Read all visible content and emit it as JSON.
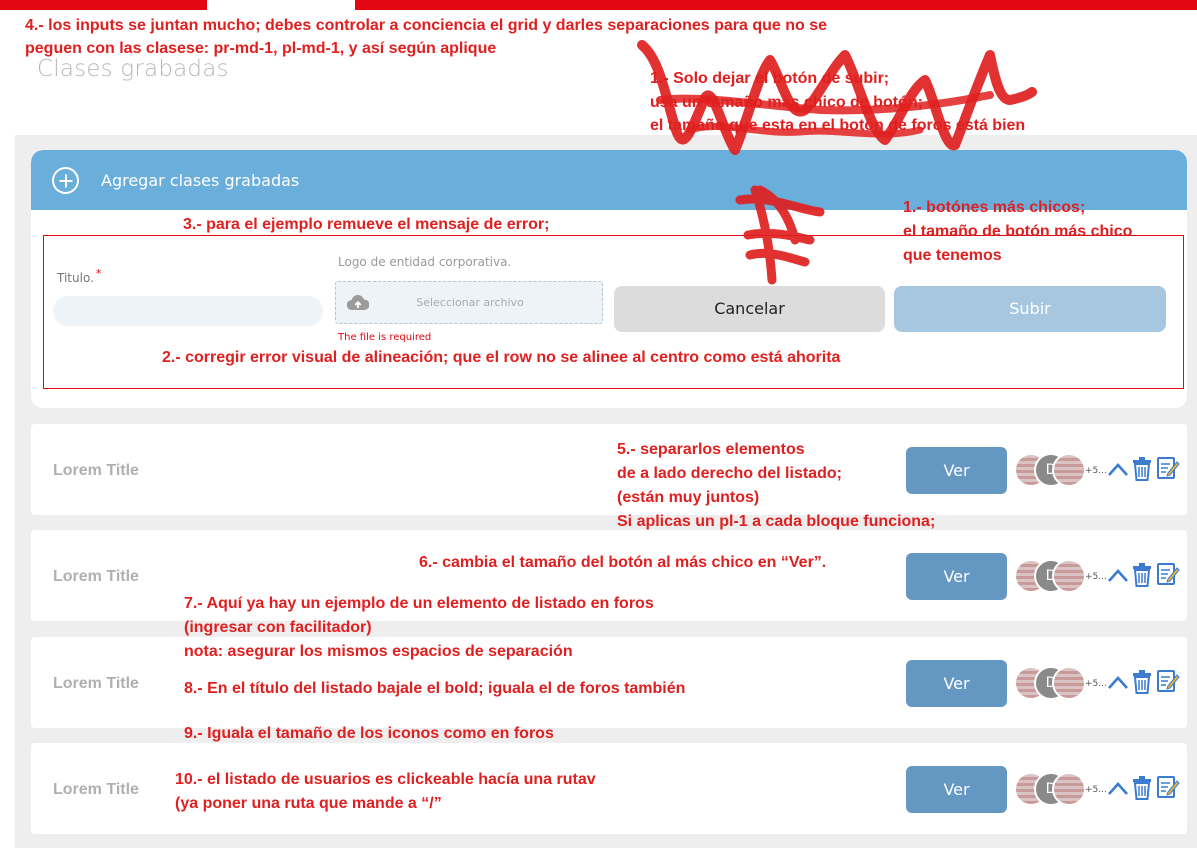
{
  "page": {
    "title": "Clases grabadas"
  },
  "add_card": {
    "title": "Agregar clases grabadas",
    "title_label": "Titulo.",
    "required_mark": "*",
    "title_value": "",
    "file_label": "Logo de entidad corporativa.",
    "file_button": "Seleccionar archivo",
    "file_error": "The file is required",
    "cancel_label": "Cancelar",
    "upload_label": "Subir"
  },
  "list": {
    "rows": [
      {
        "title": "Lorem Title",
        "view_label": "Ver",
        "avatar_initial": "D",
        "more_count": "+5..."
      },
      {
        "title": "Lorem Title",
        "view_label": "Ver",
        "avatar_initial": "D",
        "more_count": "+5..."
      },
      {
        "title": "Lorem Title",
        "view_label": "Ver",
        "avatar_initial": "D",
        "more_count": "+5..."
      },
      {
        "title": "Lorem Title",
        "view_label": "Ver",
        "avatar_initial": "D",
        "more_count": "+5..."
      }
    ]
  },
  "annotations": {
    "a4_line1": "4.- los inputs se juntan mucho; debes controlar a conciencia el grid y darles separaciones para que no se",
    "a4_line2": "peguen con las clasese: pr-md-1, pl-md-1, y así según aplique",
    "a_upload_line1": "1.- Solo dejar el botón de subir;",
    "a_upload_line2": "usa un tamaño más chico de botón;",
    "a_upload_line3": "el tamaño que esta en el botón de foros está bien",
    "a3": "3.- para el ejemplo remueve el mensaje de error;",
    "a1_line1": "1.- botónes más chicos;",
    "a1_line2": "el tamaño de botón más chico",
    "a1_line3": "que tenemos",
    "a2": "2.- corregir error visual de alineación; que el row no se alinee al centro como está ahorita",
    "a5_line1": "5.- separarlos elementos",
    "a5_line2": "de a lado derecho del listado;",
    "a5_line3": "(están muy juntos)",
    "a5_line4": "Si aplicas un pl-1 a cada bloque funciona;",
    "a6": "6.- cambia el tamaño del botón al más chico en “Ver”.",
    "a7_line1": "7.- Aquí ya hay un ejemplo de un elemento de listado en foros",
    "a7_line2": "(ingresar con facilitador)",
    "a7_line3": "nota: asegurar los mismos espacios de separación",
    "a8": "8.- En el título del listado bajale el bold; iguala el de foros también",
    "a9": "9.- Iguala el tamaño de los iconos como en foros",
    "a10_line1": "10.- el listado de usuarios es clickeable hacía una rutav",
    "a10_line2": "(ya poner una ruta que mande a “/”"
  },
  "colors": {
    "brand_red": "#e30613",
    "header_blue": "#6aaedb",
    "ver_button": "#6498c2",
    "upload_button": "#a6c7df",
    "cancel_button": "#dcdcdc",
    "annotation_red": "#e02020"
  },
  "icons": {
    "add": "plus-circle-icon",
    "upload": "cloud-upload-icon",
    "move_up": "chevron-up-icon",
    "delete": "trash-icon",
    "edit": "edit-icon"
  }
}
